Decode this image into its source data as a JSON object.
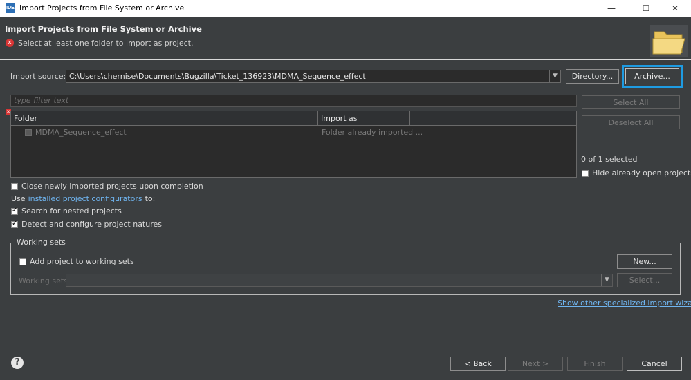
{
  "window": {
    "title": "Import Projects from File System or Archive",
    "app_icon": "IDE"
  },
  "header": {
    "title": "Import Projects from File System or Archive",
    "message": "Select at least one folder to import as project."
  },
  "import_source": {
    "label": "Import source:",
    "value": "C:\\Users\\chernise\\Documents\\Bugzilla\\Ticket_136923\\MDMA_Sequence_effect",
    "directory_button": "Directory...",
    "archive_button": "Archive..."
  },
  "filter": {
    "placeholder": "type filter text"
  },
  "table": {
    "columns": [
      "Folder",
      "Import as"
    ],
    "rows": [
      {
        "folder": "MDMA_Sequence_effect",
        "import_as": "Folder already imported ..."
      }
    ]
  },
  "side": {
    "select_all": "Select All",
    "deselect_all": "Deselect All",
    "selected_count": "0 of 1 selected",
    "hide_open_label": "Hide already open projects"
  },
  "options": {
    "close_imported": "Close newly imported projects upon completion",
    "use_prefix": "Use",
    "configurators_link": "installed project configurators",
    "use_suffix": "to:",
    "search_nested": "Search for nested projects",
    "detect_natures": "Detect and configure project natures"
  },
  "working_sets": {
    "legend": "Working sets",
    "add_label": "Add project to working sets",
    "new_button": "New...",
    "sets_label": "Working sets:",
    "select_button": "Select..."
  },
  "wizards_link": "Show other specialized import wizards",
  "footer": {
    "back": "< Back",
    "next": "Next >",
    "finish": "Finish",
    "cancel": "Cancel"
  },
  "colors": {
    "background": "#3b3e40",
    "accent_focus": "#1e9be2",
    "link": "#6fb4ef",
    "error": "#d93535"
  }
}
